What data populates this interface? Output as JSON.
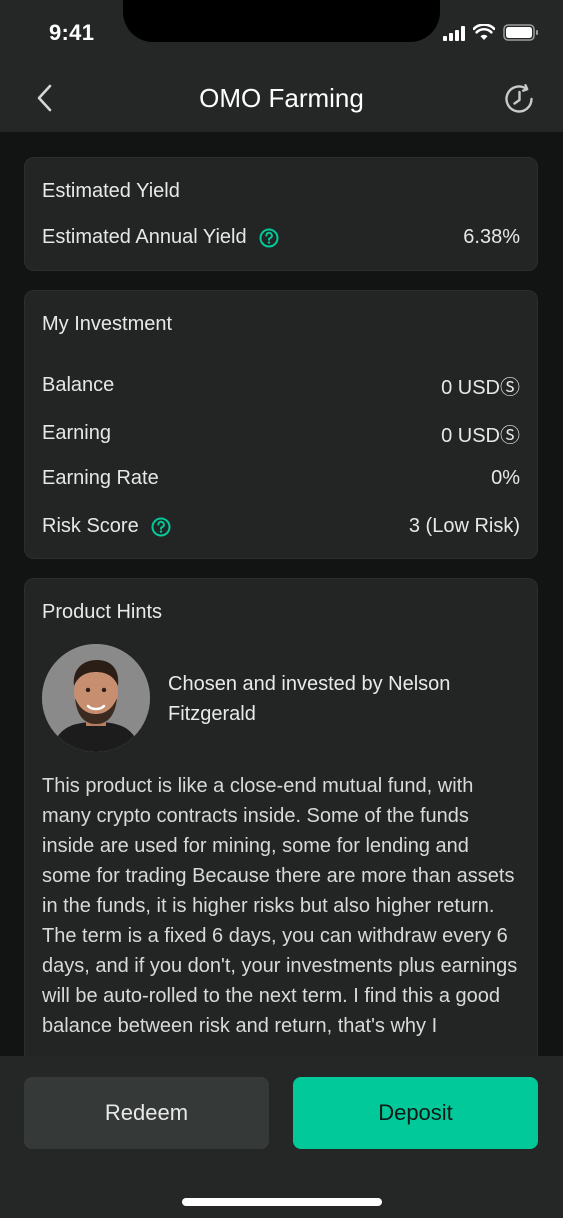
{
  "status": {
    "time": "9:41"
  },
  "header": {
    "title": "OMO Farming"
  },
  "estimated_yield": {
    "title": "Estimated Yield",
    "label": "Estimated Annual Yield",
    "value": "6.38%"
  },
  "investment": {
    "title": "My Investment",
    "rows": [
      {
        "label": "Balance",
        "value": "0 USDⓈ"
      },
      {
        "label": "Earning",
        "value": "0 USDⓈ"
      },
      {
        "label": "Earning Rate",
        "value": "0%"
      },
      {
        "label": "Risk Score",
        "value": "3 (Low Risk)"
      }
    ]
  },
  "hints": {
    "title": "Product Hints",
    "chosen_by": "Chosen and invested by Nelson Fitzgerald",
    "text": "This product is like a close-end mutual fund, with many crypto contracts inside. Some of the funds inside are used for mining, some for lending and some for trading Because there are more than assets in the funds, it is higher risks but also higher return. The term is a fixed 6 days, you can withdraw every 6 days, and if you don't, your investments plus earnings will be auto-rolled to the next term. I find this a good balance between risk and return, that's why I"
  },
  "actions": {
    "redeem": "Redeem",
    "deposit": "Deposit"
  },
  "colors": {
    "accent": "#02c99a",
    "background": "#121413",
    "card": "#232524"
  }
}
